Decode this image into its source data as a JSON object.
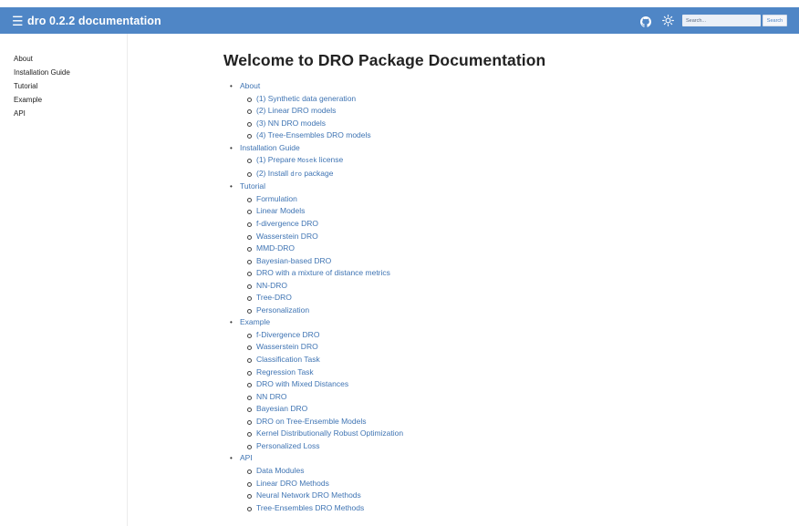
{
  "header": {
    "menu_icon": "☰",
    "title": "dro 0.2.2 documentation",
    "github_icon": "github-icon",
    "theme_icon": "sun-icon",
    "search_placeholder": "Search...",
    "search_button": "Search",
    "bar_color": "#4f86c6"
  },
  "sidebar": {
    "items": [
      "About",
      "Installation Guide",
      "Tutorial",
      "Example",
      "API"
    ]
  },
  "main": {
    "title": "Welcome to DRO Package Documentation",
    "sections": [
      {
        "label": "About",
        "items": [
          "(1) Synthetic data generation",
          "(2) Linear DRO models",
          "(3) NN DRO models",
          "(4) Tree-Ensembles DRO models"
        ]
      },
      {
        "label": "Installation Guide",
        "items": [
          {
            "pre": "(1) Prepare ",
            "code": "Mosek",
            "post": " license"
          },
          {
            "pre": "(2) Install ",
            "code": "dro",
            "post": " package"
          }
        ]
      },
      {
        "label": "Tutorial",
        "items": [
          "Formulation",
          "Linear Models",
          "f-divergence DRO",
          "Wasserstein DRO",
          "MMD-DRO",
          "Bayesian-based DRO",
          "DRO with a mixture of distance metrics",
          "NN-DRO",
          "Tree-DRO",
          "Personalization"
        ]
      },
      {
        "label": "Example",
        "items": [
          "f-Divergence DRO",
          "Wasserstein DRO",
          "Classification Task",
          "Regression Task",
          "DRO with Mixed Distances",
          "NN DRO",
          "Bayesian DRO",
          "DRO on Tree-Ensemble Models",
          "Kernel Distributionally Robust Optimization",
          "Personalized Loss"
        ]
      },
      {
        "label": "API",
        "items": [
          "Data Modules",
          "Linear DRO Methods",
          "Neural Network DRO Methods",
          "Tree-Ensembles DRO Methods"
        ]
      }
    ]
  }
}
